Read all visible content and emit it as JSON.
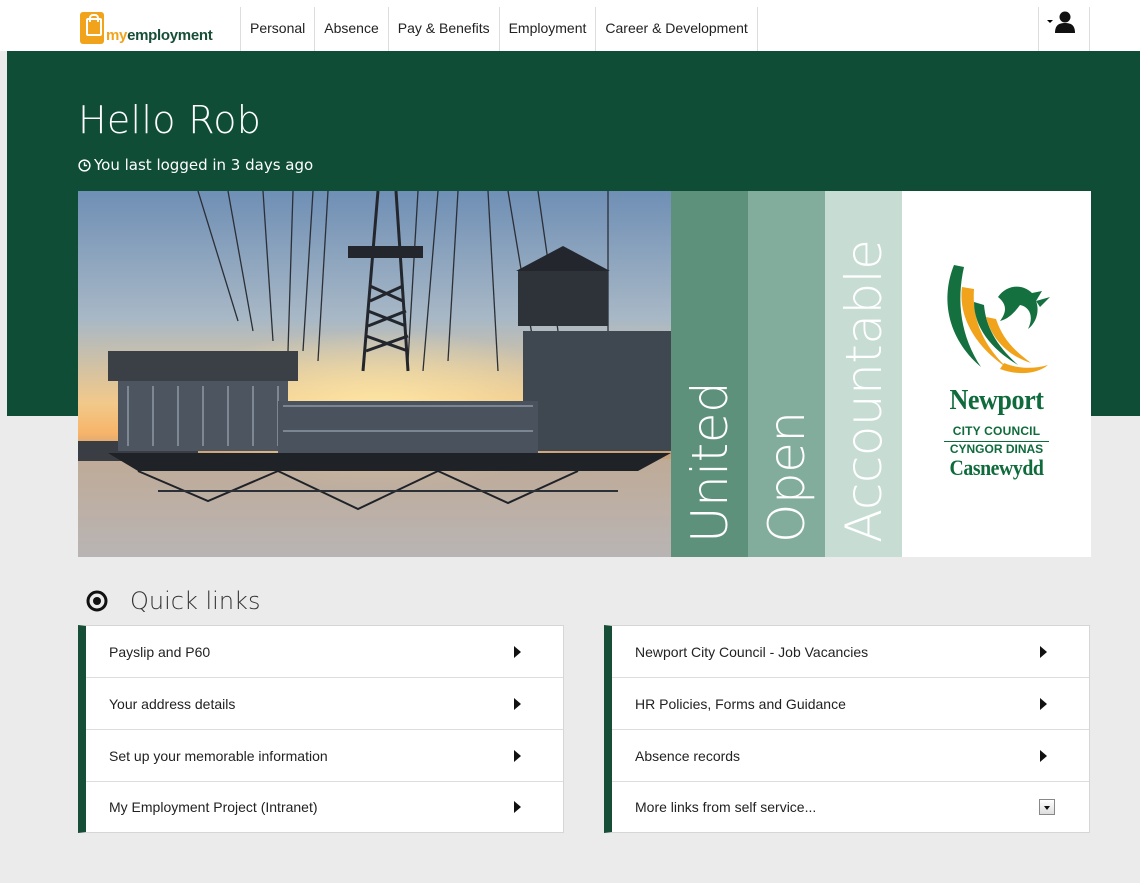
{
  "brand": {
    "my": "my",
    "employment": "employment"
  },
  "nav": {
    "tabs": [
      {
        "label": "Personal"
      },
      {
        "label": "Absence"
      },
      {
        "label": "Pay & Benefits"
      },
      {
        "label": "Employment"
      },
      {
        "label": "Career & Development"
      }
    ],
    "user_icon": "user-icon"
  },
  "hero": {
    "greeting": "Hello Rob",
    "last_login": "You last logged in 3 days ago",
    "values": [
      "United",
      "Open",
      "Accountable"
    ],
    "council": {
      "name": "Newport",
      "subtitle": "CITY COUNCIL",
      "welsh_line1": "CYNGOR DINAS",
      "welsh_line2": "Casnewydd"
    }
  },
  "quick_links": {
    "title": "Quick links",
    "left": [
      {
        "label": "Payslip and P60"
      },
      {
        "label": "Your address details"
      },
      {
        "label": "Set up your memorable information"
      },
      {
        "label": "My Employment Project (Intranet)"
      }
    ],
    "right": [
      {
        "label": "Newport City Council - Job Vacancies"
      },
      {
        "label": "HR Policies, Forms and Guidance"
      },
      {
        "label": "Absence records"
      },
      {
        "label": "More links from self service..."
      }
    ]
  },
  "colors": {
    "brand_green": "#0f4d36",
    "accent_orange": "#f0a31b",
    "stripe_1": "#5e917c",
    "stripe_2": "#82ad9c",
    "stripe_3": "#c7ddd4"
  }
}
